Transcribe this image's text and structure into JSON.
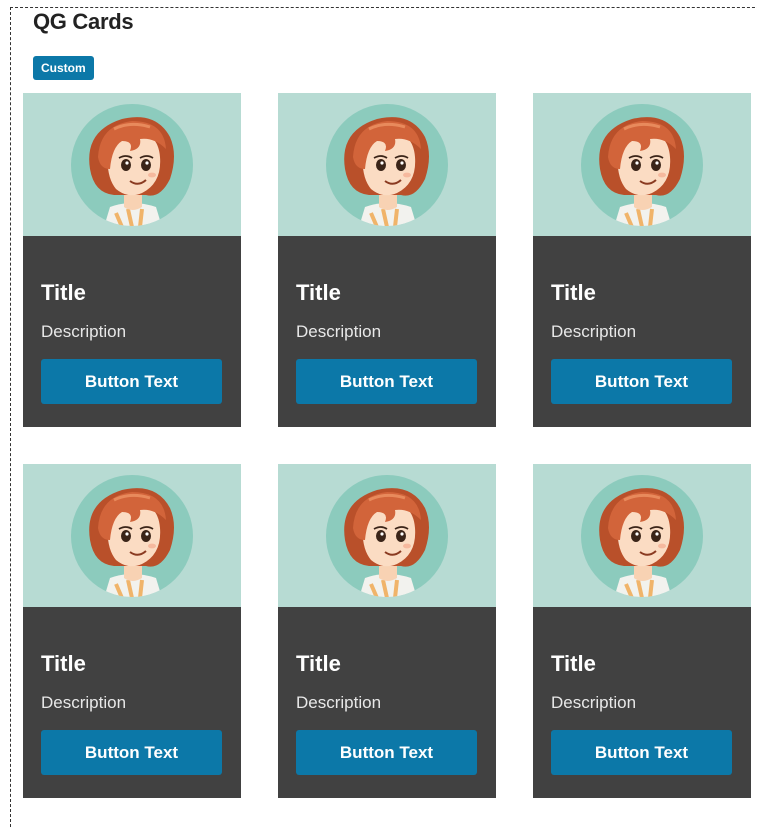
{
  "header": {
    "title": "QG Cards",
    "badge": "Custom"
  },
  "colors": {
    "accent": "#0c78a8",
    "card_body": "#414141",
    "card_media": "#b7dbd3"
  },
  "cards": [
    {
      "title": "Title",
      "description": "Description",
      "button_label": "Button Text",
      "image": "avatar-girl-icon"
    },
    {
      "title": "Title",
      "description": "Description",
      "button_label": "Button Text",
      "image": "avatar-girl-icon"
    },
    {
      "title": "Title",
      "description": "Description",
      "button_label": "Button Text",
      "image": "avatar-girl-icon"
    },
    {
      "title": "Title",
      "description": "Description",
      "button_label": "Button Text",
      "image": "avatar-girl-icon"
    },
    {
      "title": "Title",
      "description": "Description",
      "button_label": "Button Text",
      "image": "avatar-girl-icon"
    },
    {
      "title": "Title",
      "description": "Description",
      "button_label": "Button Text",
      "image": "avatar-girl-icon"
    }
  ]
}
